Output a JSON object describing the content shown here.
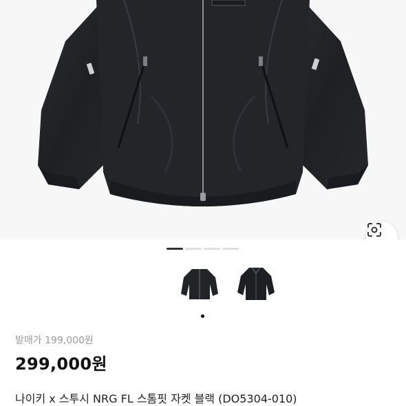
{
  "product": {
    "original_price": "발매가 199,000원",
    "price": "299,000원",
    "title": "나이키 x 스투시 NRG FL 스톰핏 자켓 블랙 (DO5304-010)"
  },
  "gallery": {
    "pages": 4,
    "active_page": 1,
    "main_image": "black-windbreaker-jacket",
    "thumbnails": [
      "jacket-thumbnail-front",
      "jacket-thumbnail-alt"
    ],
    "active_thumbnail": 1,
    "lens_icon": "visual-search-icon"
  },
  "colors": {
    "jacket": "#222326",
    "background": "#f7f7f7",
    "price": "#111111",
    "muted": "#9a9a9a"
  }
}
